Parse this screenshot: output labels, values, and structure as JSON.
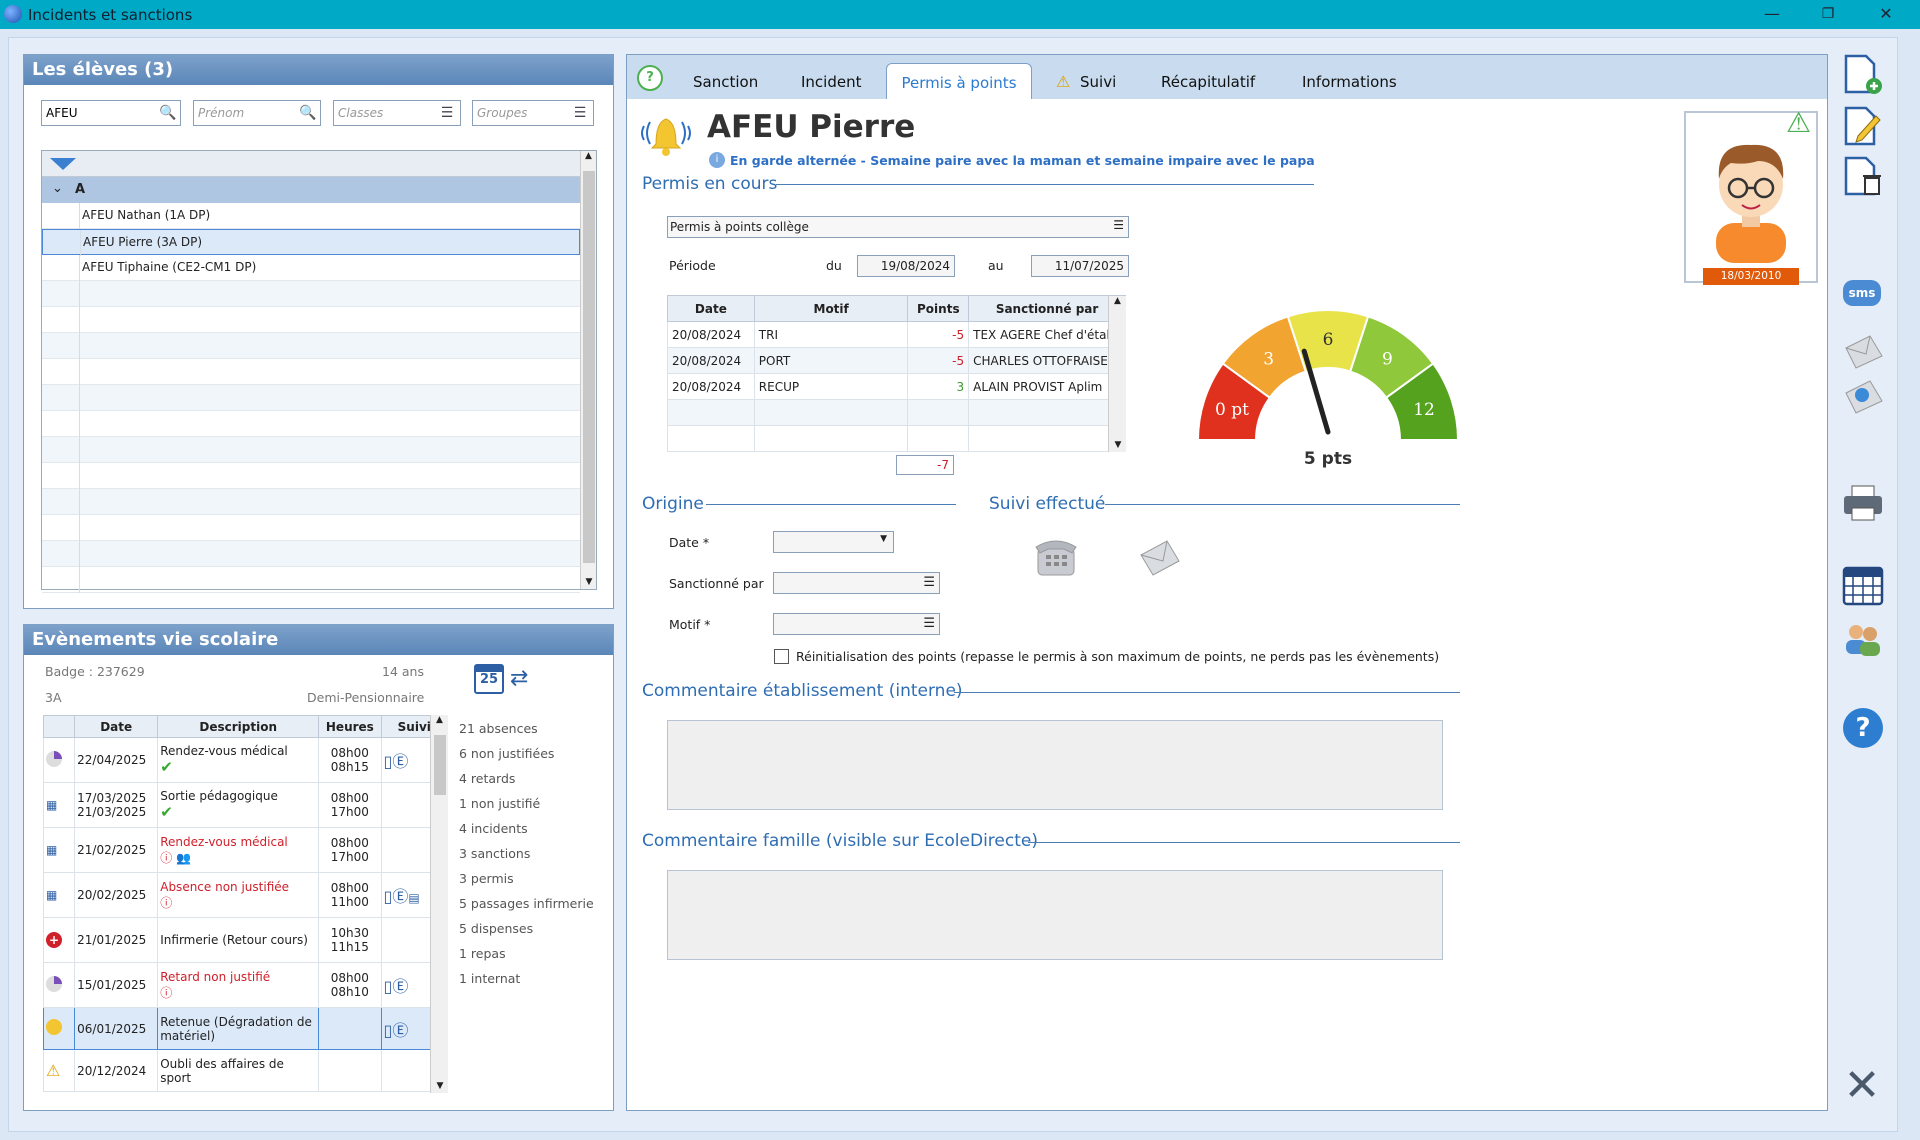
{
  "window": {
    "title": "Incidents et sanctions"
  },
  "students": {
    "header": "Les élèves (3)",
    "search": {
      "nom": "AFEU",
      "prenom_placeholder": "Prénom",
      "classes_placeholder": "Classes",
      "groupes_placeholder": "Groupes"
    },
    "group_letter": "A",
    "items": [
      {
        "label": "AFEU Nathan (1A DP)"
      },
      {
        "label": "AFEU Pierre (3A DP)"
      },
      {
        "label": "AFEU Tiphaine (CE2-CM1 DP)"
      }
    ]
  },
  "events": {
    "header": "Evènements vie scolaire",
    "badge": "Badge : 237629",
    "age": "14 ans",
    "classe": "3A",
    "regime": "Demi-Pensionnaire",
    "calendar_day": "25",
    "columns": [
      "Date",
      "Description",
      "Heures",
      "Suivi"
    ],
    "rows": [
      {
        "date": "22/04/2025",
        "desc": "Rendez-vous médical",
        "h1": "08h00",
        "h2": "08h15",
        "desc_red": false
      },
      {
        "date": "17/03/2025",
        "date2": "21/03/2025",
        "desc": "Sortie pédagogique",
        "h1": "08h00",
        "h2": "17h00",
        "desc_red": false
      },
      {
        "date": "21/02/2025",
        "desc": "Rendez-vous médical",
        "h1": "08h00",
        "h2": "17h00",
        "desc_red": true
      },
      {
        "date": "20/02/2025",
        "desc": "Absence non justifiée",
        "h1": "08h00",
        "h2": "11h00",
        "desc_red": true
      },
      {
        "date": "21/01/2025",
        "desc": "Infirmerie (Retour cours)",
        "h1": "10h30",
        "h2": "11h15",
        "desc_red": false
      },
      {
        "date": "15/01/2025",
        "desc": "Retard non justifié",
        "h1": "08h00",
        "h2": "08h10",
        "desc_red": true
      },
      {
        "date": "06/01/2025",
        "desc": "Retenue (Dégradation de matériel)",
        "h1": "",
        "h2": "",
        "desc_red": false
      },
      {
        "date": "20/12/2024",
        "desc": "Oubli des affaires de sport",
        "h1": "",
        "h2": "",
        "desc_red": false
      }
    ],
    "summary": [
      "21 absences",
      "6 non justifiées",
      "4 retards",
      "1 non justifié",
      "4 incidents",
      "3 sanctions",
      "3 permis",
      "5 passages infirmerie",
      "5 dispenses",
      "1 repas",
      "1 internat"
    ]
  },
  "tabs": [
    "Sanction",
    "Incident",
    "Permis à points",
    "Suivi",
    "Récapitulatif",
    "Informations"
  ],
  "active_tab": "Permis à points",
  "student": {
    "name": "AFEU Pierre",
    "note": "En garde alternée - Semaine paire avec la maman et semaine impaire avec le papa",
    "birthdate": "18/03/2010"
  },
  "permis": {
    "section": "Permis en cours",
    "type": "Permis à points collège",
    "periode_label": "Période",
    "du_label": "du",
    "du": "19/08/2024",
    "au_label": "au",
    "au": "11/07/2025",
    "columns": [
      "Date",
      "Motif",
      "Points",
      "Sanctionné par"
    ],
    "rows": [
      {
        "date": "20/08/2024",
        "motif": "TRI",
        "points": "-5",
        "par": "TEX AGERE Chef d'établis"
      },
      {
        "date": "20/08/2024",
        "motif": "PORT",
        "points": "-5",
        "par": "CHARLES OTTOFRAISE Ap"
      },
      {
        "date": "20/08/2024",
        "motif": "RECUP",
        "points": "3",
        "par": "ALAIN PROVIST Aplim"
      }
    ],
    "total": "-7",
    "gauge": {
      "labels": [
        "0 pt",
        "3",
        "6",
        "9",
        "12"
      ],
      "value_label": "5 pts",
      "value": 5,
      "max": 12,
      "colors": [
        "#e0301e",
        "#f2a431",
        "#e9e34a",
        "#8fc83a",
        "#55a21f"
      ]
    }
  },
  "origine": {
    "section": "Origine",
    "date_label": "Date *",
    "sanctionne_label": "Sanctionné par",
    "motif_label": "Motif *",
    "reinit_label": "Réinitialisation des points (repasse le permis à son maximum de points, ne perds pas les évènements)"
  },
  "suivi_section": "Suivi effectué",
  "comment_etab": "Commentaire établissement (interne)",
  "comment_famille": "Commentaire famille (visible sur EcoleDirecte)",
  "sidebar": {
    "sms_label": "sms"
  }
}
